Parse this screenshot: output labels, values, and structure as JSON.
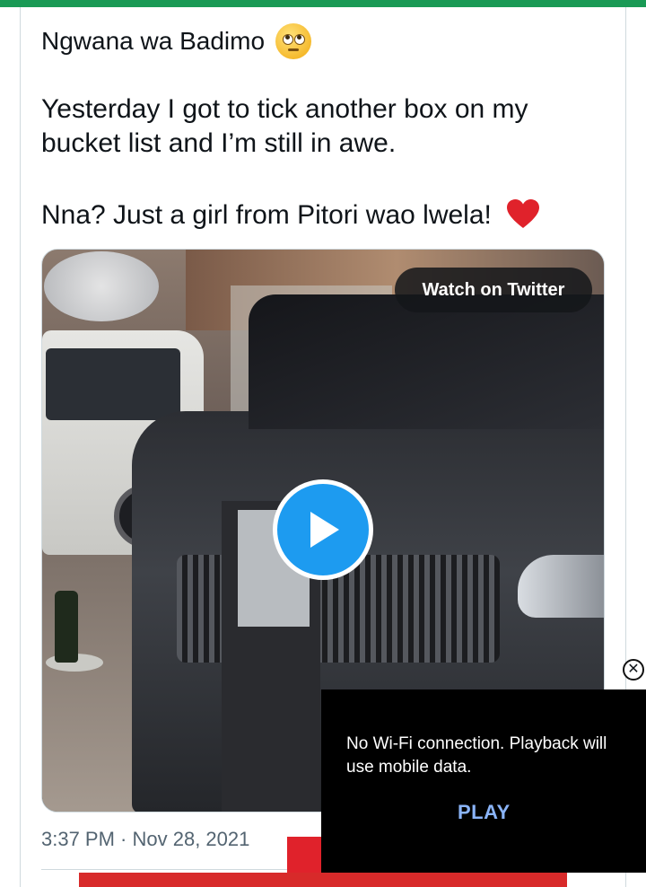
{
  "tweet": {
    "author": "Ngwana wa Badimo",
    "author_emoji": "face-with-rolling-eyes",
    "lines": [
      "Yesterday I got to tick another box on my",
      "bucket list and I’m still in awe.",
      "Nna? Just a girl from Pitori wao lwela!"
    ],
    "heart_emoji": "red-heart",
    "timestamp": "3:37 PM · Nov 28, 2021"
  },
  "media": {
    "watch_label": "Watch on Twitter",
    "play_icon": "play-icon"
  },
  "popup": {
    "message": "No Wi-Fi connection. Playback will use mobile data.",
    "action_label": "PLAY",
    "close_icon": "close-icon"
  },
  "colors": {
    "top_bar": "#1a9a55",
    "twitter_blue": "#1d9bf0",
    "heart": "#e0222b",
    "popup_action": "#8ab4f8"
  }
}
